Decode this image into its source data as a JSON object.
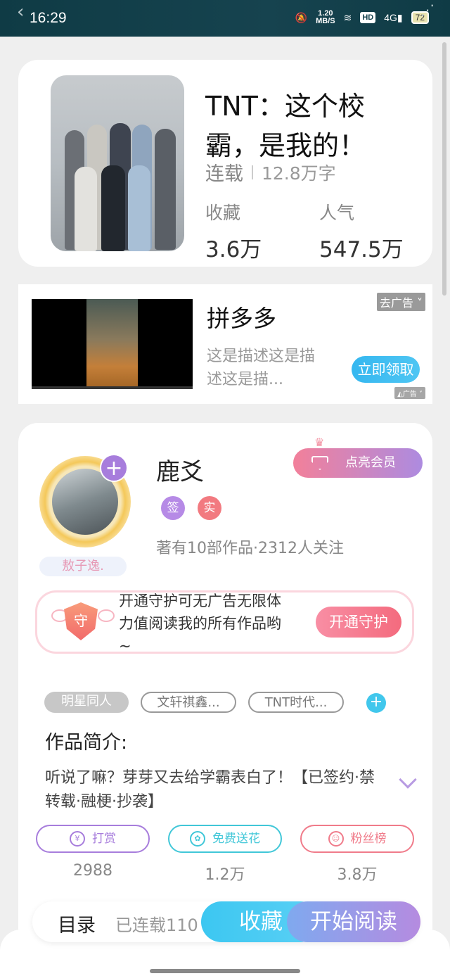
{
  "status_bar": {
    "time": "16:29",
    "net_speed_top": "1.20",
    "net_speed_unit": "MB/S",
    "hd": "HD",
    "signal": "4G",
    "battery": "72"
  },
  "book": {
    "title": "TNT：这个校霸，是我的！",
    "status": "连载",
    "word_count": "12.8万字",
    "favorites_label": "收藏",
    "favorites_value": "3.6万",
    "popularity_label": "人气",
    "popularity_value": "547.5万"
  },
  "ad": {
    "title": "拼多多",
    "description": "这是描述这是描述这是描...",
    "remove_label": "去广告",
    "cta_label": "立即领取",
    "badge_label": "广告"
  },
  "author": {
    "name": "鹿爻",
    "name_tag": "敖子逸.",
    "vip_button": "点亮会员",
    "badge_signed": "签",
    "badge_verified": "实",
    "stats": "著有10部作品·2312人关注",
    "guard_text": "开通守护可无广告无限体力值阅读我的所有作品哟~",
    "guard_icon_char": "守",
    "guard_button": "开通守护"
  },
  "tags": [
    "明星同人",
    "文轩祺鑫...",
    "TNT时代..."
  ],
  "intro": {
    "title": "作品简介:",
    "text": "听说了嘛？芽芽又去给学霸表白了！【已签约·禁转载·融梗·抄袭】"
  },
  "actions": [
    {
      "label": "打赏",
      "icon_char": "¥",
      "count": "2988",
      "color": "#a77ddc"
    },
    {
      "label": "免费送花",
      "icon_char": "✿",
      "count": "1.2万",
      "color": "#41c7d8"
    },
    {
      "label": "粉丝榜",
      "icon_char": "☺",
      "count": "3.8万",
      "color": "#f07b8a"
    }
  ],
  "bottom_bar": {
    "toc_label": "目录",
    "serial_label": "已连载110",
    "favorite_button": "收藏",
    "read_button": "开始阅读"
  }
}
